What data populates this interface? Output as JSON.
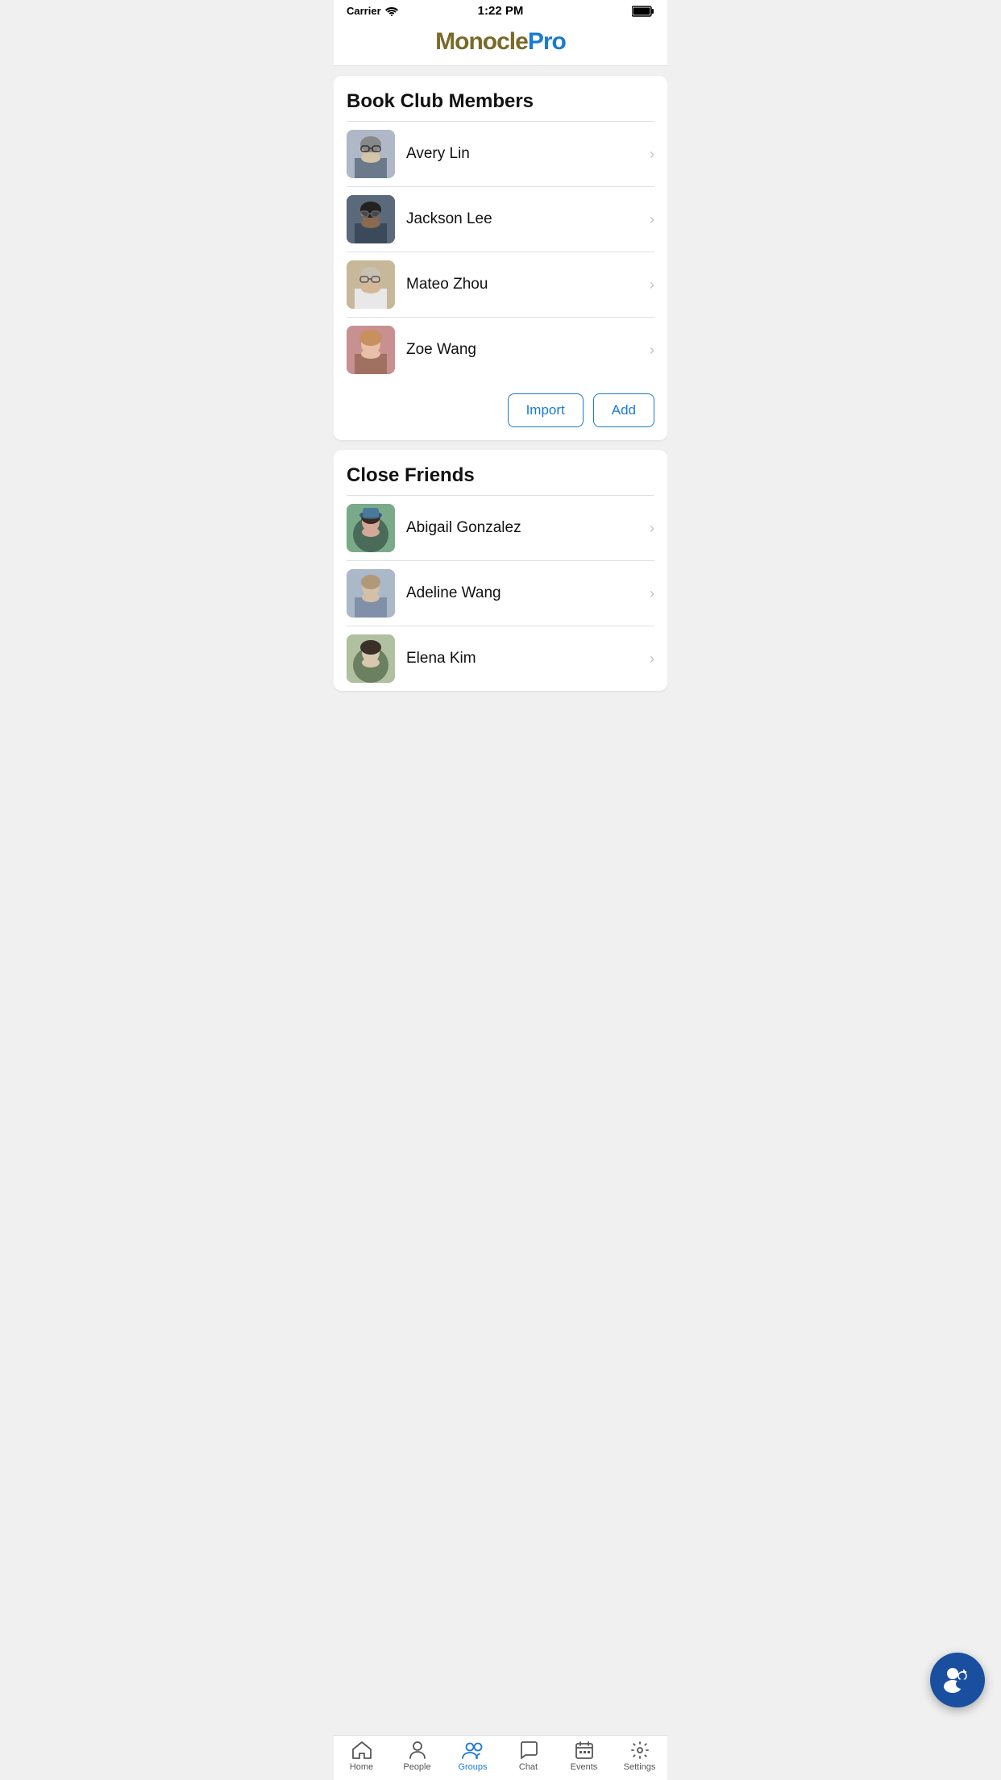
{
  "statusBar": {
    "carrier": "Carrier",
    "time": "1:22 PM",
    "battery": "■■■"
  },
  "logo": {
    "dark": "Monocle",
    "blue": "Pro"
  },
  "bookClubCard": {
    "title": "Book Club Members",
    "members": [
      {
        "id": "avery",
        "name": "Avery Lin",
        "avatarClass": "av-avery"
      },
      {
        "id": "jackson",
        "name": "Jackson Lee",
        "avatarClass": "av-jackson"
      },
      {
        "id": "mateo",
        "name": "Mateo Zhou",
        "avatarClass": "av-mateo"
      },
      {
        "id": "zoe",
        "name": "Zoe Wang",
        "avatarClass": "av-zoe"
      }
    ],
    "importLabel": "Import",
    "addLabel": "Add"
  },
  "closeFriendsCard": {
    "title": "Close Friends",
    "members": [
      {
        "id": "abigail",
        "name": "Abigail Gonzalez",
        "avatarClass": "av-abigail"
      },
      {
        "id": "adeline",
        "name": "Adeline Wang",
        "avatarClass": "av-adeline"
      },
      {
        "id": "elena",
        "name": "Elena Kim",
        "avatarClass": "av-elena"
      }
    ]
  },
  "tabs": [
    {
      "id": "home",
      "label": "Home",
      "active": false
    },
    {
      "id": "people",
      "label": "People",
      "active": false
    },
    {
      "id": "groups",
      "label": "Groups",
      "active": true
    },
    {
      "id": "chat",
      "label": "Chat",
      "active": false
    },
    {
      "id": "events",
      "label": "Events",
      "active": false
    },
    {
      "id": "settings",
      "label": "Settings",
      "active": false
    }
  ]
}
